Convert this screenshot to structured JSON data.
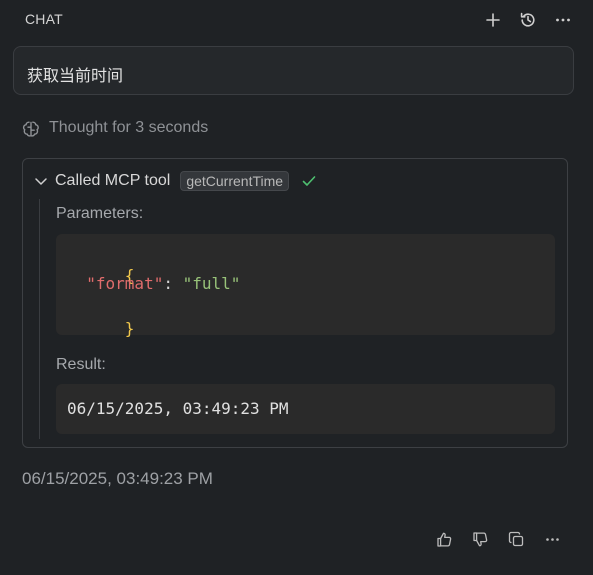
{
  "header": {
    "title": "CHAT",
    "actions": [
      "plus-icon",
      "history-icon",
      "more-icon"
    ]
  },
  "prompt": {
    "text": "获取当前时间"
  },
  "thought": {
    "text": "Thought for 3 seconds",
    "icon": "brain-icon"
  },
  "tool_call": {
    "label": "Called MCP tool",
    "tool_name": "getCurrentTime",
    "status": "success",
    "status_color": "#4ec070",
    "parameters_label": "Parameters:",
    "parameters": {
      "open": "{",
      "key": "\"format\"",
      "colon": ": ",
      "value": "\"full\"",
      "close": "}"
    },
    "result_label": "Result:",
    "result": "06/15/2025, 03:49:23 PM"
  },
  "answer": {
    "text": "06/15/2025, 03:49:23 PM"
  },
  "feedback": {
    "actions": [
      "thumbs-up-icon",
      "thumbs-down-icon",
      "copy-icon",
      "more-icon"
    ]
  }
}
